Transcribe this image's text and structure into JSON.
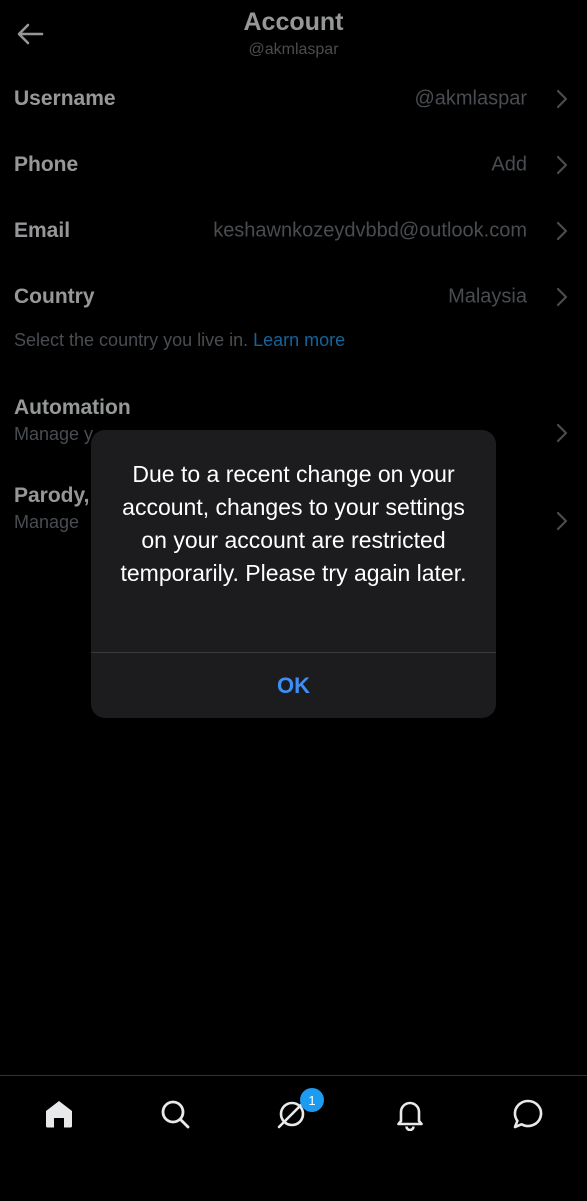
{
  "header": {
    "title": "Account",
    "subtitle": "@akmlaspar"
  },
  "rows": [
    {
      "label": "Username",
      "value": "@akmlaspar"
    },
    {
      "label": "Phone",
      "value": "Add"
    },
    {
      "label": "Email",
      "value": "keshawnkozeydvbbd@outlook.com"
    },
    {
      "label": "Country",
      "value": "Malaysia"
    }
  ],
  "country_hint": {
    "text": "Select the country you live in.",
    "link": "Learn more"
  },
  "settings": [
    {
      "label": "Automation",
      "desc": "Manage y"
    },
    {
      "label": "Parody,",
      "desc": "Manage"
    }
  ],
  "dialog": {
    "message": "Due to a recent change on your account, changes to your settings on your account are restricted temporarily. Please try again later.",
    "ok_label": "OK"
  },
  "tabbar": {
    "icons": [
      "home-icon",
      "search-icon",
      "grok-icon",
      "bell-icon",
      "messages-icon"
    ],
    "badge": "1"
  },
  "colors": {
    "accent": "#1d9bf0",
    "ok_button": "#3e8ef7",
    "muted": "#71767b"
  }
}
